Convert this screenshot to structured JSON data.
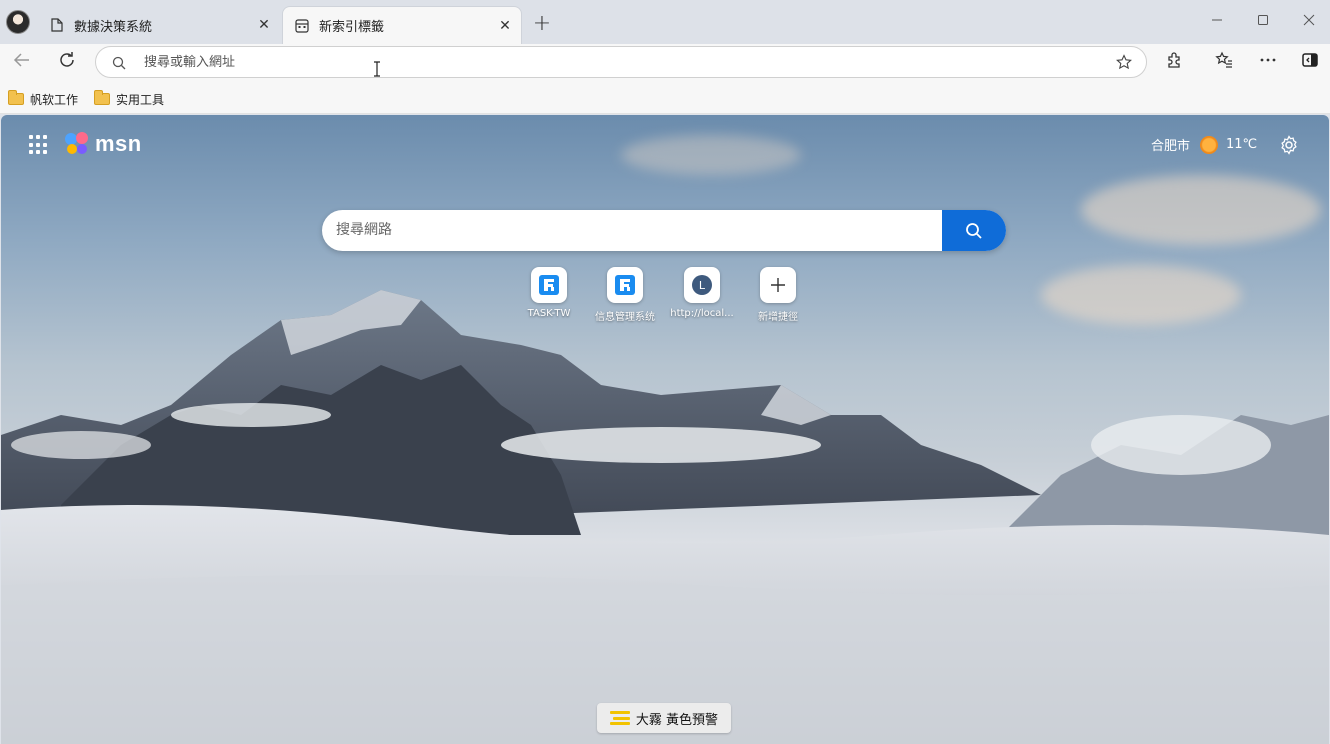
{
  "browser": {
    "tabs": [
      {
        "label": "數據決策系統",
        "icon": "page-icon",
        "active": false
      },
      {
        "label": "新索引標籤",
        "icon": "new-tab-page-icon",
        "active": true
      }
    ],
    "new_tab_symbol": "+",
    "address_bar": {
      "value": "",
      "placeholder": "搜尋或輸入網址"
    },
    "favorites": [
      {
        "label": "帆软工作",
        "icon": "folder-icon"
      },
      {
        "label": "实用工具",
        "icon": "folder-icon"
      }
    ]
  },
  "page": {
    "brand": "msn",
    "weather": {
      "city": "合肥市",
      "temperature": "11℃",
      "icon": "sun-icon"
    },
    "search": {
      "placeholder": "搜尋網路"
    },
    "quick_links": [
      {
        "label": "TASK-TW",
        "icon": "fanruan-logo-icon"
      },
      {
        "label": "信息管理系统",
        "icon": "fanruan-logo-icon"
      },
      {
        "label": "http://local...",
        "icon": "letter-l-icon",
        "letter": "L"
      },
      {
        "label": "新增捷徑",
        "icon": "plus-icon"
      }
    ],
    "alert": {
      "label": "大霧 黃色預警",
      "icon": "fog-warning-icon",
      "color": "#f2c300"
    }
  },
  "colors": {
    "accent": "#0f6cd8",
    "tab_strip": "#dde1e8",
    "toolbar": "#f7f7f7"
  }
}
